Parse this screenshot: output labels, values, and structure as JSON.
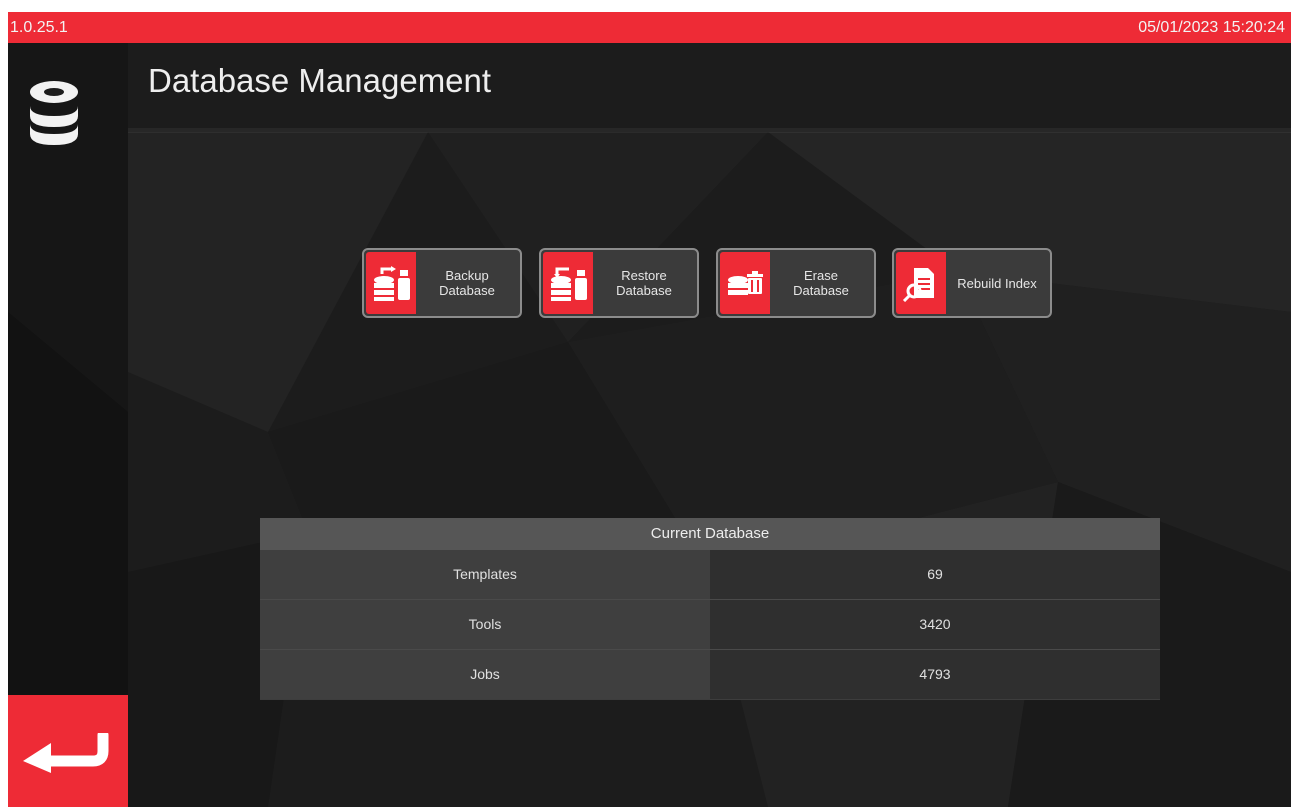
{
  "status_bar": {
    "version": "1.0.25.1",
    "datetime": "05/01/2023 15:20:24"
  },
  "header": {
    "title": "Database Management",
    "icon": "database-icon"
  },
  "actions": [
    {
      "label": "Backup\nDatabase",
      "icon": "backup-database-icon"
    },
    {
      "label": "Restore\nDatabase",
      "icon": "restore-database-icon"
    },
    {
      "label": "Erase\nDatabase",
      "icon": "erase-database-icon"
    },
    {
      "label": "Rebuild Index",
      "icon": "rebuild-index-icon"
    }
  ],
  "current_database": {
    "title": "Current Database",
    "rows": [
      {
        "label": "Templates",
        "value": "69"
      },
      {
        "label": "Tools",
        "value": "3420"
      },
      {
        "label": "Jobs",
        "value": "4793"
      }
    ]
  },
  "back_button": {
    "icon": "back-arrow-icon"
  },
  "colors": {
    "accent": "#ee2b36",
    "background": "#1c1c1c",
    "button": "#3b3b3b"
  }
}
